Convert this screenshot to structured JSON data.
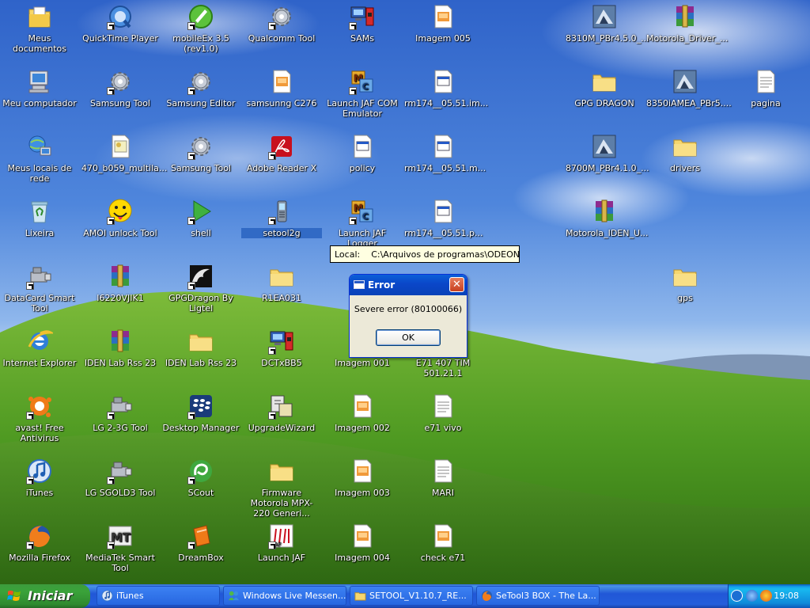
{
  "desktop": {
    "icons": [
      {
        "label": "Meus documentos",
        "icon": "my-documents-icon",
        "shortcut": false
      },
      {
        "label": "QuickTime Player",
        "icon": "quicktime-icon",
        "shortcut": true
      },
      {
        "label": "mobileEx 3.5 (rev1.0)",
        "icon": "mobileex-icon",
        "shortcut": true
      },
      {
        "label": "Qualcomm Tool",
        "icon": "gear-icon",
        "shortcut": true
      },
      {
        "label": "SAMs",
        "icon": "sams-icon",
        "shortcut": true
      },
      {
        "label": "Imagem 005",
        "icon": "image-file-icon",
        "shortcut": false
      },
      {
        "label": "8310M_PBr4.5.0_...",
        "icon": "flash-package-icon",
        "shortcut": false
      },
      {
        "label": "Motorola_Driver_...",
        "icon": "winrar-icon",
        "shortcut": false
      },
      {
        "label": "Meu computador",
        "icon": "my-computer-icon",
        "shortcut": false
      },
      {
        "label": "Samsung Tool",
        "icon": "gear-icon",
        "shortcut": true
      },
      {
        "label": "Samsung Editor",
        "icon": "gear-icon",
        "shortcut": true
      },
      {
        "label": "samsunng C276",
        "icon": "image-file-icon",
        "shortcut": false
      },
      {
        "label": "Launch JAF COM Emulator",
        "icon": "jaf-com-icon",
        "shortcut": true
      },
      {
        "label": "rm174__05.51.im...",
        "icon": "binary-file-icon",
        "shortcut": false
      },
      {
        "label": "GPG DRAGON",
        "icon": "folder-icon",
        "shortcut": false
      },
      {
        "label": "8350iAMEA_PBr5....",
        "icon": "flash-package-icon",
        "shortcut": false
      },
      {
        "label": "pagina",
        "icon": "text-file-icon",
        "shortcut": false
      },
      {
        "label": "Meus locais de rede",
        "icon": "network-places-icon",
        "shortcut": false
      },
      {
        "label": "470_b059_multila...",
        "icon": "document-icon",
        "shortcut": false
      },
      {
        "label": "Samsung Tool",
        "icon": "gear-icon",
        "shortcut": true
      },
      {
        "label": "Adobe Reader X",
        "icon": "adobe-reader-icon",
        "shortcut": true
      },
      {
        "label": "policy",
        "icon": "binary-file-icon",
        "shortcut": false
      },
      {
        "label": "rm174__05.51.m...",
        "icon": "binary-file-icon",
        "shortcut": false
      },
      {
        "label": "8700M_PBr4.1.0_...",
        "icon": "flash-package-icon",
        "shortcut": false
      },
      {
        "label": "drivers",
        "icon": "folder-icon",
        "shortcut": false
      },
      {
        "label": "Lixeira",
        "icon": "recycle-bin-icon",
        "shortcut": false
      },
      {
        "label": "AMOI unlock Tool",
        "icon": "smiley-icon",
        "shortcut": true
      },
      {
        "label": "shell",
        "icon": "play-arrow-icon",
        "shortcut": true
      },
      {
        "label": "setool2g",
        "icon": "phone-tool-icon",
        "shortcut": true
      },
      {
        "label": "Launch JAF Logger",
        "icon": "jaf-com-icon",
        "shortcut": true
      },
      {
        "label": "rm174__05.51.p...",
        "icon": "binary-file-icon",
        "shortcut": false
      },
      {
        "label": "Motorola_IDEN_U...",
        "icon": "winrar-icon",
        "shortcut": false
      },
      {
        "label": "DataCard Smart Tool",
        "icon": "usb-tool-icon",
        "shortcut": true
      },
      {
        "label": "I6220VJIK1",
        "icon": "winrar-icon",
        "shortcut": false
      },
      {
        "label": "GPGDragon By Ligtel",
        "icon": "dragon-icon",
        "shortcut": true
      },
      {
        "label": "R1EA031",
        "icon": "folder-icon",
        "shortcut": false
      },
      {
        "label": "gps",
        "icon": "folder-icon",
        "shortcut": false
      },
      {
        "label": "Internet Explorer",
        "icon": "internet-explorer-icon",
        "shortcut": false
      },
      {
        "label": "IDEN Lab Rss 23",
        "icon": "winrar-icon",
        "shortcut": false
      },
      {
        "label": "IDEN Lab Rss 23",
        "icon": "folder-icon",
        "shortcut": false
      },
      {
        "label": "DCTxBB5",
        "icon": "sams-icon",
        "shortcut": true
      },
      {
        "label": "Imagem 001",
        "icon": "image-file-icon",
        "shortcut": false
      },
      {
        "label": "E71 407 TIM 501.21.1",
        "icon": "text-file-icon",
        "shortcut": false
      },
      {
        "label": "avast! Free Antivirus",
        "icon": "avast-icon",
        "shortcut": true
      },
      {
        "label": "LG 2-3G Tool",
        "icon": "usb-tool-icon",
        "shortcut": true
      },
      {
        "label": "Desktop Manager",
        "icon": "blackberry-icon",
        "shortcut": true
      },
      {
        "label": "UpgradeWizard",
        "icon": "upgrade-wizard-icon",
        "shortcut": true
      },
      {
        "label": "Imagem 002",
        "icon": "image-file-icon",
        "shortcut": false
      },
      {
        "label": "e71 vivo",
        "icon": "text-file-icon",
        "shortcut": false
      },
      {
        "label": "iTunes",
        "icon": "itunes-icon",
        "shortcut": true
      },
      {
        "label": "LG SGOLD3 Tool",
        "icon": "usb-tool-icon",
        "shortcut": true
      },
      {
        "label": "SCout",
        "icon": "scout-icon",
        "shortcut": true
      },
      {
        "label": "Firmware Motorola MPX-220 Generi...",
        "icon": "folder-icon",
        "shortcut": false
      },
      {
        "label": "Imagem 003",
        "icon": "image-file-icon",
        "shortcut": false
      },
      {
        "label": "MARI",
        "icon": "text-file-icon",
        "shortcut": false
      },
      {
        "label": "Mozilla Firefox",
        "icon": "firefox-icon",
        "shortcut": true
      },
      {
        "label": "MediaTek Smart Tool",
        "icon": "mediatek-icon",
        "shortcut": true
      },
      {
        "label": "DreamBox",
        "icon": "dreambox-icon",
        "shortcut": true
      },
      {
        "label": "Launch JAF",
        "icon": "jaf-icon",
        "shortcut": true
      },
      {
        "label": "Imagem 004",
        "icon": "image-file-icon",
        "shortcut": false
      },
      {
        "label": "check e71",
        "icon": "image-file-icon",
        "shortcut": false
      }
    ],
    "selected_icon": "setool2g"
  },
  "tooltip": {
    "label": "Local:",
    "path": "C:\\Arquivos de programas\\ODEON\\JAF"
  },
  "dialog": {
    "title": "Error",
    "message": "Severe error (80100066)",
    "ok_label": "OK",
    "close_glyph": "✕",
    "icon": "window-icon"
  },
  "taskbar": {
    "start_label": "Iniciar",
    "buttons": [
      {
        "label": "iTunes",
        "icon": "itunes-icon"
      },
      {
        "label": "Windows Live Messen...",
        "icon": "messenger-icon"
      },
      {
        "label": "SETOOL_V1.10.7_RE...",
        "icon": "folder-icon"
      },
      {
        "label": "SeTool3 BOX - The La...",
        "icon": "firefox-icon"
      }
    ],
    "tray": {
      "clock": "19:08",
      "icons": [
        "show-hidden-icon",
        "network-icon",
        "antivirus-icon"
      ]
    }
  },
  "colors": {
    "selection": "#316ac5",
    "taskbar": "#245edb",
    "start_button": "#3aa33a",
    "dialog_face": "#ece9d8",
    "tooltip_bg": "#ffffe1"
  }
}
